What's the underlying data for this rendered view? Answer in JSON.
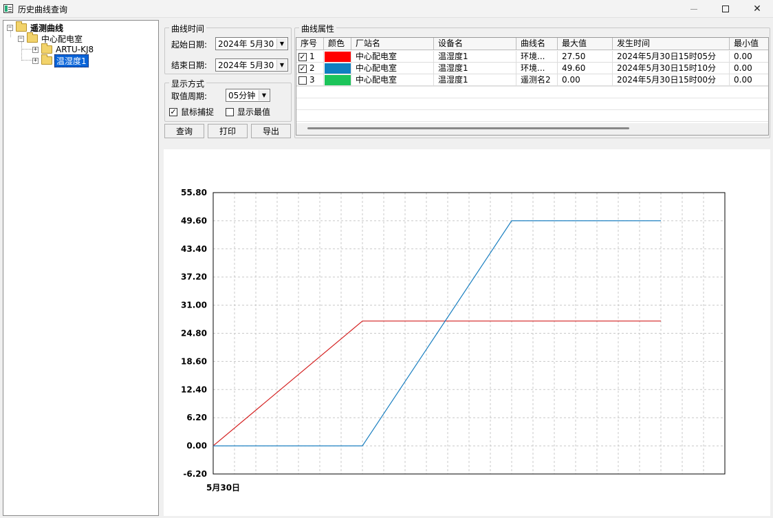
{
  "window": {
    "title": "历史曲线查询"
  },
  "tree": {
    "root": "遥测曲线",
    "station": "中心配电室",
    "devices": [
      "ARTU-KJ8",
      "温湿度1"
    ],
    "selected": "温湿度1"
  },
  "curve_time": {
    "title": "曲线时间",
    "start_label": "起始日期:",
    "start_value": "2024年 5月30",
    "end_label": "结束日期:",
    "end_value": "2024年 5月30"
  },
  "display_mode": {
    "title": "显示方式",
    "period_label": "取值周期:",
    "period_value": "05分钟",
    "mouse_capture_label": "鼠标捕捉",
    "mouse_capture_checked": true,
    "show_extreme_label": "显示最值",
    "show_extreme_checked": false
  },
  "buttons": {
    "query": "查询",
    "print": "打印",
    "export": "导出"
  },
  "curve_props": {
    "title": "曲线属性",
    "columns": [
      "序号",
      "颜色",
      "厂站名",
      "设备名",
      "曲线名",
      "最大值",
      "发生时间",
      "最小值"
    ],
    "rows": [
      {
        "index": "1",
        "checked": true,
        "color": "#ff0000",
        "station": "中心配电室",
        "device": "温湿度1",
        "curve": "环境...",
        "max": "27.50",
        "time": "2024年5月30日15时05分",
        "min": "0.00"
      },
      {
        "index": "2",
        "checked": true,
        "color": "#0f7fc0",
        "station": "中心配电室",
        "device": "温湿度1",
        "curve": "环境...",
        "max": "49.60",
        "time": "2024年5月30日15时10分",
        "min": "0.00"
      },
      {
        "index": "3",
        "checked": false,
        "color": "#1cc45a",
        "station": "中心配电室",
        "device": "温湿度1",
        "curve": "遥测名2",
        "max": "0.00",
        "time": "2024年5月30日15时00分",
        "min": "0.00"
      }
    ]
  },
  "chart_data": {
    "type": "line",
    "x_label_text": "5月30日",
    "ylim": [
      -6.2,
      55.8
    ],
    "yticks": [
      "55.80",
      "49.60",
      "43.40",
      "37.20",
      "31.00",
      "24.80",
      "18.60",
      "12.40",
      "6.20",
      "0.00",
      "-6.20"
    ],
    "grid": true,
    "x_steps": 24,
    "x_range_steps": 24,
    "series": [
      {
        "color": "#d42020",
        "x": [
          0,
          7,
          21
        ],
        "y": [
          0.0,
          27.5,
          27.5
        ]
      },
      {
        "color": "#1a7fc0",
        "x": [
          0,
          7,
          14,
          21
        ],
        "y": [
          0.0,
          0.0,
          49.6,
          49.6
        ]
      }
    ]
  }
}
